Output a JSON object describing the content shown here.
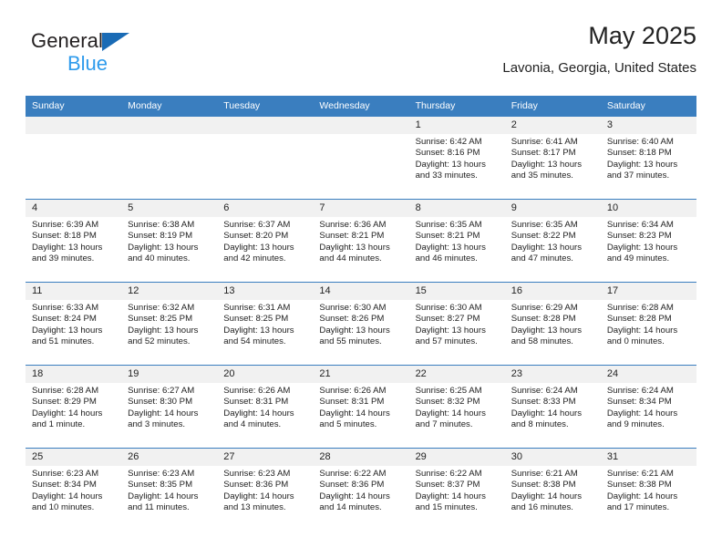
{
  "brand": {
    "line1": "General",
    "line2": "Blue",
    "triangle_color": "#1a6bb5",
    "blue_text_color": "#2e9bec"
  },
  "header": {
    "title": "May 2025",
    "subtitle": "Lavonia, Georgia, United States"
  },
  "theme": {
    "header_row_bg": "#3a7ebf",
    "daynum_bg": "#f1f1f1",
    "grid_line": "#3a7ebf"
  },
  "weekday_headers": [
    "Sunday",
    "Monday",
    "Tuesday",
    "Wednesday",
    "Thursday",
    "Friday",
    "Saturday"
  ],
  "weeks": [
    [
      {
        "day": "",
        "sunrise": "",
        "sunset": "",
        "daylight1": "",
        "daylight2": ""
      },
      {
        "day": "",
        "sunrise": "",
        "sunset": "",
        "daylight1": "",
        "daylight2": ""
      },
      {
        "day": "",
        "sunrise": "",
        "sunset": "",
        "daylight1": "",
        "daylight2": ""
      },
      {
        "day": "",
        "sunrise": "",
        "sunset": "",
        "daylight1": "",
        "daylight2": ""
      },
      {
        "day": "1",
        "sunrise": "Sunrise: 6:42 AM",
        "sunset": "Sunset: 8:16 PM",
        "daylight1": "Daylight: 13 hours",
        "daylight2": "and 33 minutes."
      },
      {
        "day": "2",
        "sunrise": "Sunrise: 6:41 AM",
        "sunset": "Sunset: 8:17 PM",
        "daylight1": "Daylight: 13 hours",
        "daylight2": "and 35 minutes."
      },
      {
        "day": "3",
        "sunrise": "Sunrise: 6:40 AM",
        "sunset": "Sunset: 8:18 PM",
        "daylight1": "Daylight: 13 hours",
        "daylight2": "and 37 minutes."
      }
    ],
    [
      {
        "day": "4",
        "sunrise": "Sunrise: 6:39 AM",
        "sunset": "Sunset: 8:18 PM",
        "daylight1": "Daylight: 13 hours",
        "daylight2": "and 39 minutes."
      },
      {
        "day": "5",
        "sunrise": "Sunrise: 6:38 AM",
        "sunset": "Sunset: 8:19 PM",
        "daylight1": "Daylight: 13 hours",
        "daylight2": "and 40 minutes."
      },
      {
        "day": "6",
        "sunrise": "Sunrise: 6:37 AM",
        "sunset": "Sunset: 8:20 PM",
        "daylight1": "Daylight: 13 hours",
        "daylight2": "and 42 minutes."
      },
      {
        "day": "7",
        "sunrise": "Sunrise: 6:36 AM",
        "sunset": "Sunset: 8:21 PM",
        "daylight1": "Daylight: 13 hours",
        "daylight2": "and 44 minutes."
      },
      {
        "day": "8",
        "sunrise": "Sunrise: 6:35 AM",
        "sunset": "Sunset: 8:21 PM",
        "daylight1": "Daylight: 13 hours",
        "daylight2": "and 46 minutes."
      },
      {
        "day": "9",
        "sunrise": "Sunrise: 6:35 AM",
        "sunset": "Sunset: 8:22 PM",
        "daylight1": "Daylight: 13 hours",
        "daylight2": "and 47 minutes."
      },
      {
        "day": "10",
        "sunrise": "Sunrise: 6:34 AM",
        "sunset": "Sunset: 8:23 PM",
        "daylight1": "Daylight: 13 hours",
        "daylight2": "and 49 minutes."
      }
    ],
    [
      {
        "day": "11",
        "sunrise": "Sunrise: 6:33 AM",
        "sunset": "Sunset: 8:24 PM",
        "daylight1": "Daylight: 13 hours",
        "daylight2": "and 51 minutes."
      },
      {
        "day": "12",
        "sunrise": "Sunrise: 6:32 AM",
        "sunset": "Sunset: 8:25 PM",
        "daylight1": "Daylight: 13 hours",
        "daylight2": "and 52 minutes."
      },
      {
        "day": "13",
        "sunrise": "Sunrise: 6:31 AM",
        "sunset": "Sunset: 8:25 PM",
        "daylight1": "Daylight: 13 hours",
        "daylight2": "and 54 minutes."
      },
      {
        "day": "14",
        "sunrise": "Sunrise: 6:30 AM",
        "sunset": "Sunset: 8:26 PM",
        "daylight1": "Daylight: 13 hours",
        "daylight2": "and 55 minutes."
      },
      {
        "day": "15",
        "sunrise": "Sunrise: 6:30 AM",
        "sunset": "Sunset: 8:27 PM",
        "daylight1": "Daylight: 13 hours",
        "daylight2": "and 57 minutes."
      },
      {
        "day": "16",
        "sunrise": "Sunrise: 6:29 AM",
        "sunset": "Sunset: 8:28 PM",
        "daylight1": "Daylight: 13 hours",
        "daylight2": "and 58 minutes."
      },
      {
        "day": "17",
        "sunrise": "Sunrise: 6:28 AM",
        "sunset": "Sunset: 8:28 PM",
        "daylight1": "Daylight: 14 hours",
        "daylight2": "and 0 minutes."
      }
    ],
    [
      {
        "day": "18",
        "sunrise": "Sunrise: 6:28 AM",
        "sunset": "Sunset: 8:29 PM",
        "daylight1": "Daylight: 14 hours",
        "daylight2": "and 1 minute."
      },
      {
        "day": "19",
        "sunrise": "Sunrise: 6:27 AM",
        "sunset": "Sunset: 8:30 PM",
        "daylight1": "Daylight: 14 hours",
        "daylight2": "and 3 minutes."
      },
      {
        "day": "20",
        "sunrise": "Sunrise: 6:26 AM",
        "sunset": "Sunset: 8:31 PM",
        "daylight1": "Daylight: 14 hours",
        "daylight2": "and 4 minutes."
      },
      {
        "day": "21",
        "sunrise": "Sunrise: 6:26 AM",
        "sunset": "Sunset: 8:31 PM",
        "daylight1": "Daylight: 14 hours",
        "daylight2": "and 5 minutes."
      },
      {
        "day": "22",
        "sunrise": "Sunrise: 6:25 AM",
        "sunset": "Sunset: 8:32 PM",
        "daylight1": "Daylight: 14 hours",
        "daylight2": "and 7 minutes."
      },
      {
        "day": "23",
        "sunrise": "Sunrise: 6:24 AM",
        "sunset": "Sunset: 8:33 PM",
        "daylight1": "Daylight: 14 hours",
        "daylight2": "and 8 minutes."
      },
      {
        "day": "24",
        "sunrise": "Sunrise: 6:24 AM",
        "sunset": "Sunset: 8:34 PM",
        "daylight1": "Daylight: 14 hours",
        "daylight2": "and 9 minutes."
      }
    ],
    [
      {
        "day": "25",
        "sunrise": "Sunrise: 6:23 AM",
        "sunset": "Sunset: 8:34 PM",
        "daylight1": "Daylight: 14 hours",
        "daylight2": "and 10 minutes."
      },
      {
        "day": "26",
        "sunrise": "Sunrise: 6:23 AM",
        "sunset": "Sunset: 8:35 PM",
        "daylight1": "Daylight: 14 hours",
        "daylight2": "and 11 minutes."
      },
      {
        "day": "27",
        "sunrise": "Sunrise: 6:23 AM",
        "sunset": "Sunset: 8:36 PM",
        "daylight1": "Daylight: 14 hours",
        "daylight2": "and 13 minutes."
      },
      {
        "day": "28",
        "sunrise": "Sunrise: 6:22 AM",
        "sunset": "Sunset: 8:36 PM",
        "daylight1": "Daylight: 14 hours",
        "daylight2": "and 14 minutes."
      },
      {
        "day": "29",
        "sunrise": "Sunrise: 6:22 AM",
        "sunset": "Sunset: 8:37 PM",
        "daylight1": "Daylight: 14 hours",
        "daylight2": "and 15 minutes."
      },
      {
        "day": "30",
        "sunrise": "Sunrise: 6:21 AM",
        "sunset": "Sunset: 8:38 PM",
        "daylight1": "Daylight: 14 hours",
        "daylight2": "and 16 minutes."
      },
      {
        "day": "31",
        "sunrise": "Sunrise: 6:21 AM",
        "sunset": "Sunset: 8:38 PM",
        "daylight1": "Daylight: 14 hours",
        "daylight2": "and 17 minutes."
      }
    ]
  ]
}
